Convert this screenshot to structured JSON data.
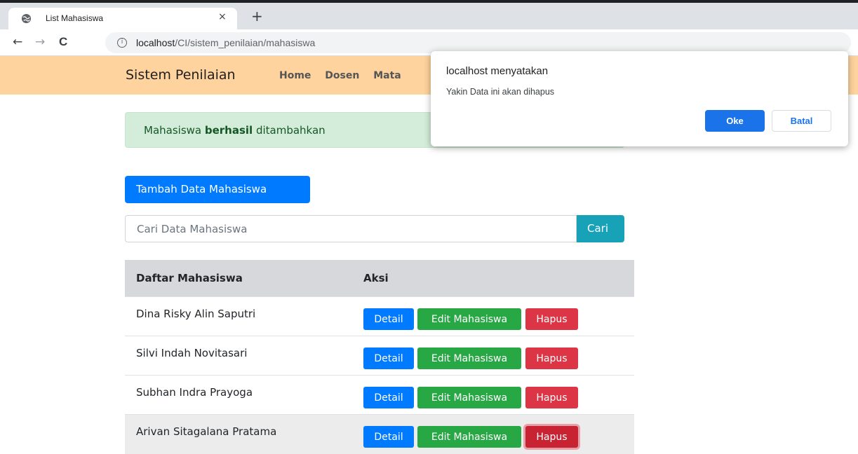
{
  "browser": {
    "tab_title": "List Mahasiswa",
    "tab_close": "×",
    "new_tab": "+",
    "url_host": "localhost",
    "url_path": "/CI/sistem_penilaian/mahasiswa",
    "back": "←",
    "forward": "→",
    "reload": "C"
  },
  "navbar": {
    "brand": "Sistem Penilaian",
    "links": [
      "Home",
      "Dosen",
      "Mata"
    ]
  },
  "alert": {
    "prefix": "Mahasiswa ",
    "bold": "berhasil",
    "suffix": " ditambahkan"
  },
  "actions": {
    "add_label": "Tambah Data Mahasiswa",
    "search_placeholder": "Cari Data Mahasiswa",
    "search_button": "Cari"
  },
  "table": {
    "headers": [
      "Daftar Mahasiswa",
      "Aksi"
    ],
    "rows": [
      {
        "name": "Dina Risky Alin Saputri"
      },
      {
        "name": "Silvi Indah Novitasari"
      },
      {
        "name": "Subhan Indra Prayoga"
      },
      {
        "name": "Arivan Sitagalana Pratama"
      }
    ],
    "detail_label": "Detail",
    "edit_label": "Edit Mahasiswa",
    "delete_label": "Hapus"
  },
  "dialog": {
    "title": "localhost menyatakan",
    "message": "Yakin Data ini akan dihapus",
    "ok": "Oke",
    "cancel": "Batal"
  },
  "colors": {
    "navbar": "#ffd39e",
    "primary": "#007bff",
    "success": "#28a745",
    "danger": "#dc3545",
    "info": "#17a2b8"
  }
}
